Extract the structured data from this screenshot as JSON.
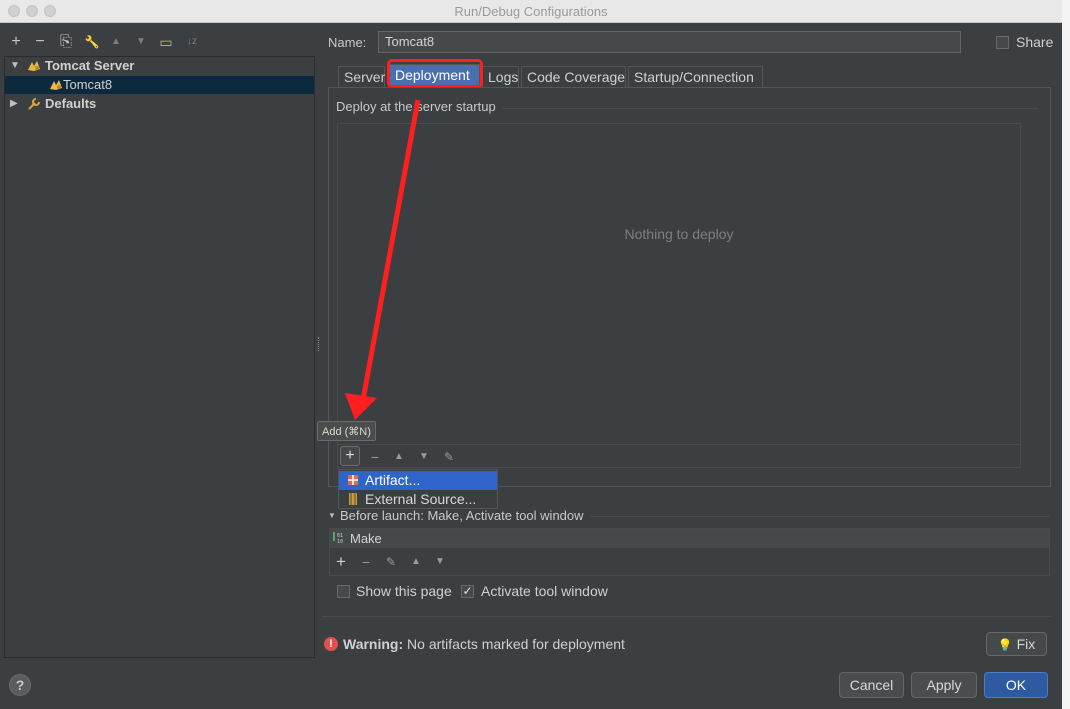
{
  "window": {
    "title": "Run/Debug Configurations"
  },
  "left_toolbar": {
    "icons": [
      "add-icon",
      "remove-icon",
      "copy-icon",
      "wrench-icon",
      "move-up-icon",
      "move-down-icon",
      "folder-icon",
      "sort-icon"
    ],
    "glyphs": {
      "add": "+",
      "remove": "−",
      "copy": "⎘",
      "wrench": "🔧",
      "up": "▲",
      "down": "▼",
      "folder": "▭",
      "sort": "↓z"
    }
  },
  "tree": {
    "tomcat_server_label": "Tomcat Server",
    "tomcat8_label": "Tomcat8",
    "defaults_label": "Defaults"
  },
  "name": {
    "label": "Name:",
    "value": "Tomcat8"
  },
  "share": {
    "label": "Share",
    "checked": false
  },
  "tabs": [
    {
      "label": "Server"
    },
    {
      "label": "Deployment",
      "active": true
    },
    {
      "label": "Logs"
    },
    {
      "label": "Code Coverage"
    },
    {
      "label": "Startup/Connection"
    }
  ],
  "deployment": {
    "header": "Deploy at the server startup",
    "empty_text": "Nothing to deploy",
    "tooltip": "Add (⌘N)",
    "popup": [
      {
        "label": "Artifact...",
        "icon": "artifact-icon",
        "selected": true
      },
      {
        "label": "External Source...",
        "icon": "external-source-icon",
        "selected": false
      }
    ]
  },
  "before_launch": {
    "header": "Before launch: Make, Activate tool window",
    "items": [
      {
        "label": "Make",
        "icon": "make-icon"
      }
    ]
  },
  "options": {
    "show_this_page": {
      "label": "Show this page",
      "checked": false
    },
    "activate_tool_window": {
      "label": "Activate tool window",
      "checked": true
    }
  },
  "warning": {
    "prefix": "Warning:",
    "text": "No artifacts marked for deployment",
    "fix_label": "Fix"
  },
  "buttons": {
    "help": "?",
    "cancel": "Cancel",
    "apply": "Apply",
    "ok": "OK"
  },
  "colors": {
    "accent": "#4b6eaf",
    "selection": "#2f65ca",
    "annotation": "#ff1f1f",
    "background": "#3c3f41"
  }
}
